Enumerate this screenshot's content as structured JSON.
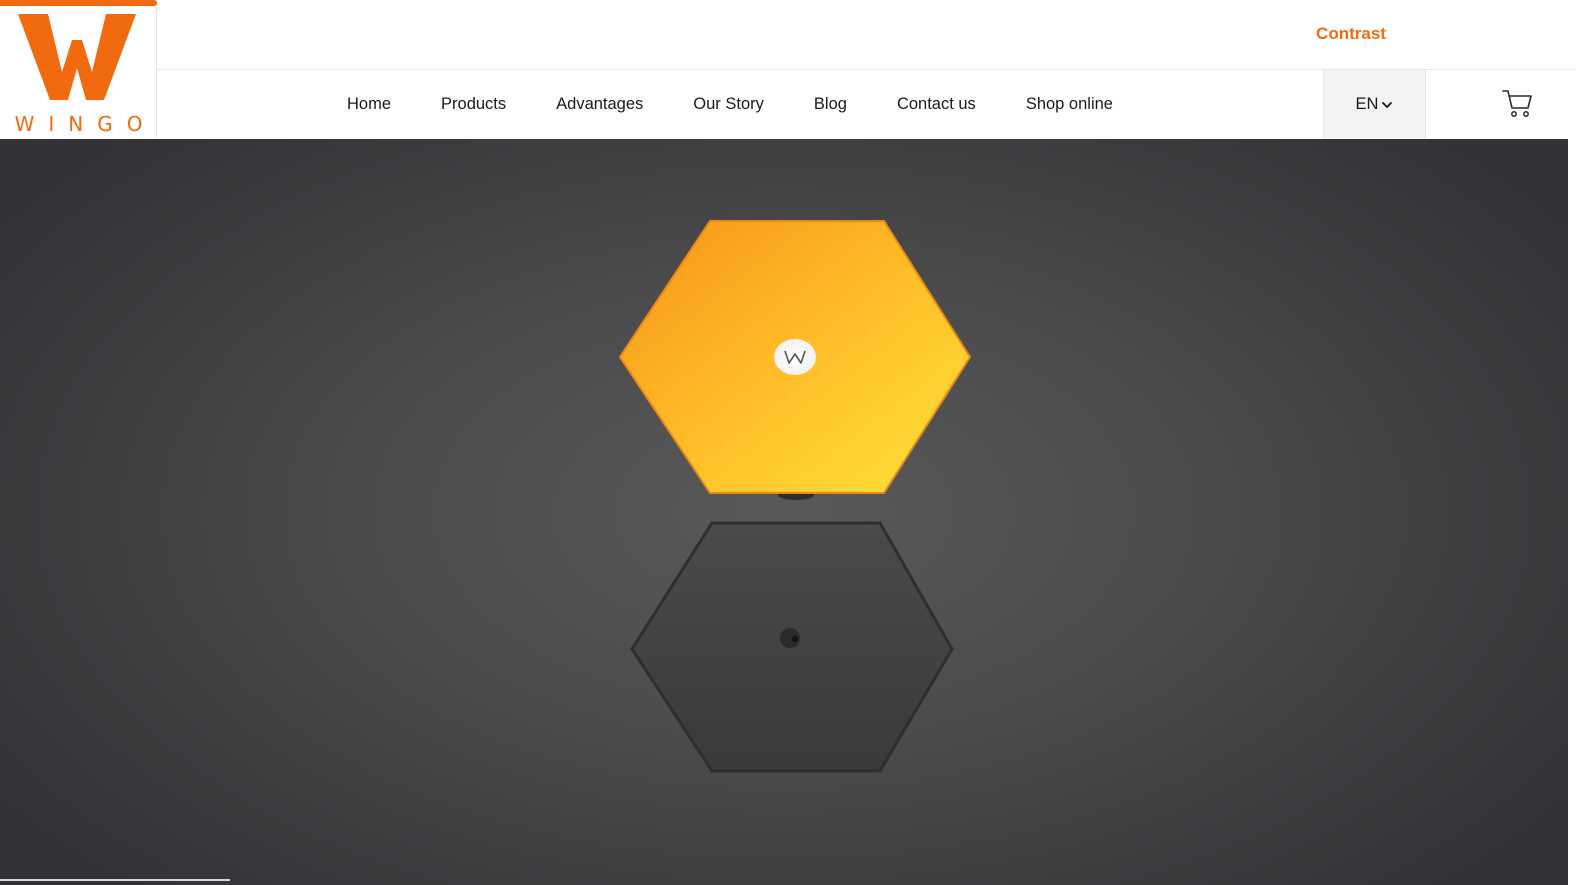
{
  "brand": {
    "name": "WINGO",
    "accent_color": "#f26a10"
  },
  "topbar": {
    "contrast_label": "Contrast"
  },
  "nav": {
    "items": [
      {
        "label": "Home"
      },
      {
        "label": "Products"
      },
      {
        "label": "Advantages"
      },
      {
        "label": "Our Story"
      },
      {
        "label": "Blog"
      },
      {
        "label": "Contact us"
      },
      {
        "label": "Shop online"
      }
    ]
  },
  "language": {
    "selected": "EN",
    "icon": "chevron-down-icon"
  },
  "cart": {
    "icon": "cart-icon"
  },
  "hero": {
    "product": "hexagon panel light",
    "panel_color": "#ffb21a",
    "background_color": "#4b4a4c"
  }
}
